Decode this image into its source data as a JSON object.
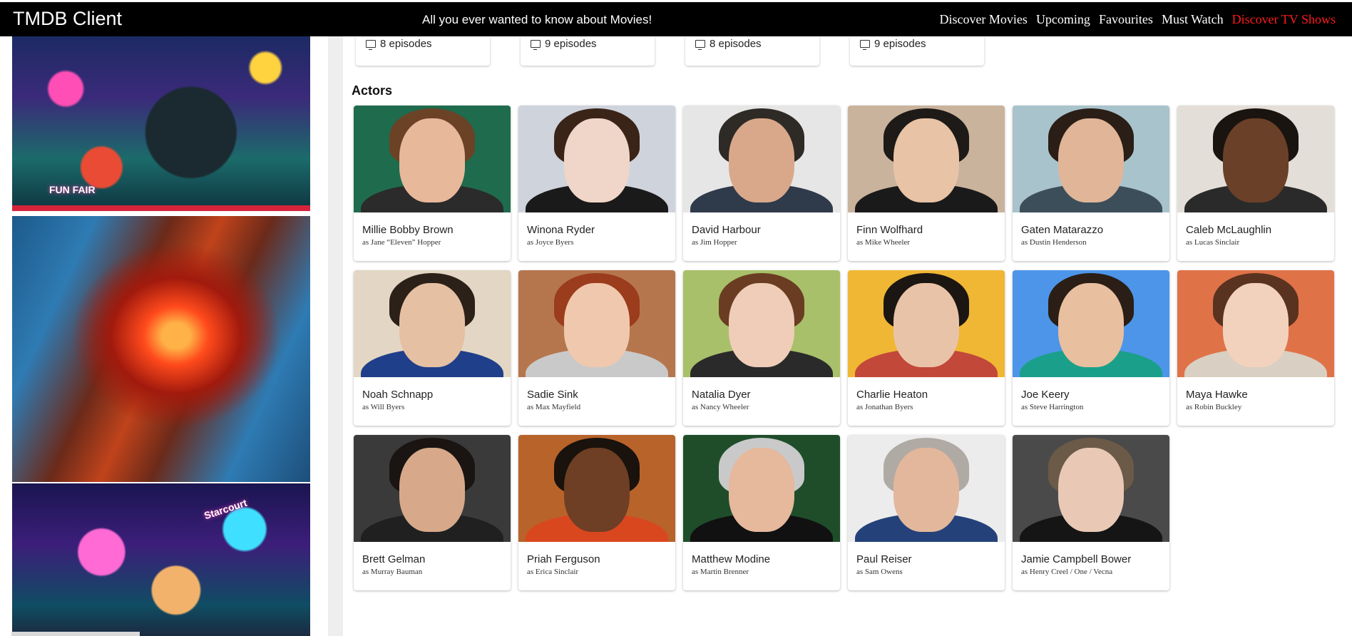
{
  "header": {
    "brand": "TMDB Client",
    "tagline": "All you ever wanted to know about Movies!",
    "nav": [
      {
        "label": "Discover Movies",
        "active": false
      },
      {
        "label": "Upcoming",
        "active": false
      },
      {
        "label": "Favourites",
        "active": false
      },
      {
        "label": "Must Watch",
        "active": false
      },
      {
        "label": "Discover TV Shows",
        "active": true
      }
    ]
  },
  "posters": {
    "labels": [
      "FUN FAIR",
      "Starcourt"
    ]
  },
  "seasons": [
    {
      "episodes": "8 episodes"
    },
    {
      "episodes": "9 episodes"
    },
    {
      "episodes": "8 episodes"
    },
    {
      "episodes": "9 episodes"
    }
  ],
  "actors_section": {
    "title": "Actors",
    "actors": [
      {
        "name": "Millie Bobby Brown",
        "role": "as Jane “Eleven” Hopper",
        "bg": "#1f6b4e",
        "skin": "#e8b89a",
        "hair": "#6b4226",
        "top": "#2b2b2b"
      },
      {
        "name": "Winona Ryder",
        "role": "as Joyce Byers",
        "bg": "#cfd3dc",
        "skin": "#f0d6c8",
        "hair": "#3a2418",
        "top": "#1a1a1a"
      },
      {
        "name": "David Harbour",
        "role": "as Jim Hopper",
        "bg": "#e6e6e6",
        "skin": "#d9a88a",
        "hair": "#2e2a26",
        "top": "#2f3a4a"
      },
      {
        "name": "Finn Wolfhard",
        "role": "as Mike Wheeler",
        "bg": "#c9b39c",
        "skin": "#e8c3a5",
        "hair": "#1d1a18",
        "top": "#1a1a1a"
      },
      {
        "name": "Gaten Matarazzo",
        "role": "as Dustin Henderson",
        "bg": "#a9c3cc",
        "skin": "#e0b598",
        "hair": "#2a1e16",
        "top": "#3c4e5a"
      },
      {
        "name": "Caleb McLaughlin",
        "role": "as Lucas Sinclair",
        "bg": "#e4ded8",
        "skin": "#6b4028",
        "hair": "#1a1410",
        "top": "#2a2a2a"
      },
      {
        "name": "Noah Schnapp",
        "role": "as Will Byers",
        "bg": "#e3d6c4",
        "skin": "#e6c0a2",
        "hair": "#2c2118",
        "top": "#1f3f8a"
      },
      {
        "name": "Sadie Sink",
        "role": "as Max Mayfield",
        "bg": "#b5764e",
        "skin": "#f0c8ae",
        "hair": "#9b3c1c",
        "top": "#c9c9c9"
      },
      {
        "name": "Natalia Dyer",
        "role": "as Nancy Wheeler",
        "bg": "#a9c06a",
        "skin": "#efcdb8",
        "hair": "#6a3d22",
        "top": "#2a2a2a"
      },
      {
        "name": "Charlie Heaton",
        "role": "as Jonathan Byers",
        "bg": "#f0b735",
        "skin": "#e9c3a8",
        "hair": "#1c1612",
        "top": "#c2483a"
      },
      {
        "name": "Joe Keery",
        "role": "as Steve Harrington",
        "bg": "#4d95e8",
        "skin": "#e8bf9f",
        "hair": "#2a1e16",
        "top": "#1aa08a"
      },
      {
        "name": "Maya Hawke",
        "role": "as Robin Buckley",
        "bg": "#e07248",
        "skin": "#f2d2bd",
        "hair": "#5a3220",
        "top": "#d9cfc2"
      },
      {
        "name": "Brett Gelman",
        "role": "as Murray Bauman",
        "bg": "#3a3a3a",
        "skin": "#d7a98a",
        "hair": "#1a1512",
        "top": "#202020"
      },
      {
        "name": "Priah Ferguson",
        "role": "as Erica Sinclair",
        "bg": "#b8632a",
        "skin": "#6e3f25",
        "hair": "#1a120c",
        "top": "#d9471f"
      },
      {
        "name": "Matthew Modine",
        "role": "as Martin Brenner",
        "bg": "#1f4d2a",
        "skin": "#e6b89c",
        "hair": "#c9c9c9",
        "top": "#111111"
      },
      {
        "name": "Paul Reiser",
        "role": "as Sam Owens",
        "bg": "#ececec",
        "skin": "#e3b79c",
        "hair": "#b0aaa4",
        "top": "#24417a"
      },
      {
        "name": "Jamie Campbell Bower",
        "role": "as Henry Creel / One / Vecna",
        "bg": "#4a4a4a",
        "skin": "#e9c8b6",
        "hair": "#6b5a48",
        "top": "#151515"
      }
    ]
  }
}
